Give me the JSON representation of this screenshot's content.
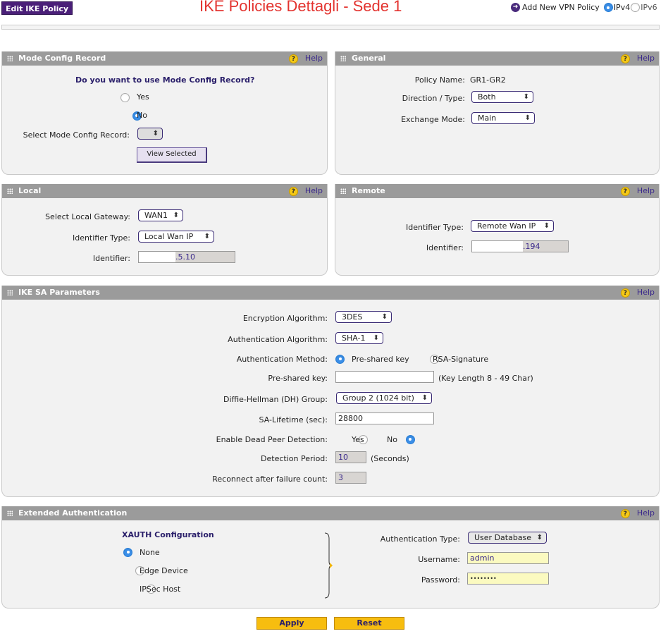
{
  "header": {
    "edit_tab": "Edit IKE Policy",
    "title": "IKE Policies  Dettagli - Sede 1",
    "add_vpn": "Add New VPN Policy",
    "ipv4": "IPv4",
    "ipv6": "IPv6"
  },
  "help_label": "Help",
  "mode_config": {
    "title": "Mode Config Record",
    "question": "Do you want to use Mode Config Record?",
    "yes": "Yes",
    "no": "No",
    "select_label": "Select Mode Config Record:",
    "select_value": "",
    "view_button": "View Selected"
  },
  "general": {
    "title": "General",
    "policy_name_label": "Policy Name:",
    "policy_name_value": "GR1-GR2",
    "direction_label": "Direction / Type:",
    "direction_value": "Both",
    "exchange_label": "Exchange Mode:",
    "exchange_value": "Main"
  },
  "local": {
    "title": "Local",
    "gateway_label": "Select Local Gateway:",
    "gateway_value": "WAN1",
    "idtype_label": "Identifier Type:",
    "idtype_value": "Local Wan IP",
    "id_label": "Identifier:",
    "id_value": ".5.10"
  },
  "remote": {
    "title": "Remote",
    "idtype_label": "Identifier Type:",
    "idtype_value": "Remote Wan IP",
    "id_label": "Identifier:",
    "id_value": ".194"
  },
  "ike_sa": {
    "title": "IKE SA Parameters",
    "enc_label": "Encryption Algorithm:",
    "enc_value": "3DES",
    "auth_alg_label": "Authentication Algorithm:",
    "auth_alg_value": "SHA-1",
    "auth_method_label": "Authentication Method:",
    "psk_option": "Pre-shared key",
    "rsa_option": "RSA-Signature",
    "psk_label": "Pre-shared key:",
    "psk_value": "",
    "psk_hint": "(Key Length 8 - 49 Char)",
    "dh_label": "Diffie-Hellman (DH) Group:",
    "dh_value": "Group 2 (1024 bit)",
    "lifetime_label": "SA-Lifetime (sec):",
    "lifetime_value": "28800",
    "dpd_label": "Enable Dead Peer Detection:",
    "dpd_yes": "Yes",
    "dpd_no": "No",
    "detect_label": "Detection Period:",
    "detect_value": "10",
    "detect_unit": "(Seconds)",
    "reconnect_label": "Reconnect after failure count:",
    "reconnect_value": "3"
  },
  "xauth": {
    "title": "Extended Authentication",
    "config_title": "XAUTH Configuration",
    "none": "None",
    "edge": "Edge Device",
    "ipsec": "IPSec Host",
    "auth_type_label": "Authentication Type:",
    "auth_type_value": "User Database",
    "username_label": "Username:",
    "username_value": "admin",
    "password_label": "Password:",
    "password_value": "••••••••"
  },
  "buttons": {
    "apply": "Apply",
    "reset": "Reset"
  }
}
